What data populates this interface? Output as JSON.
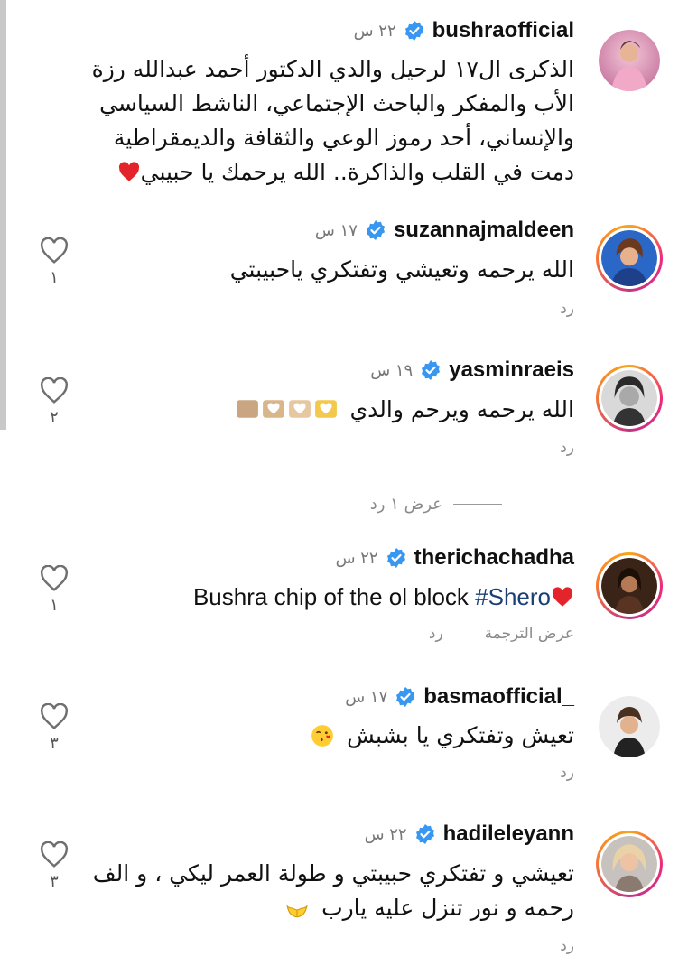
{
  "comments": [
    {
      "username": "bushraofficial",
      "time": "٢٢ س",
      "lines": [
        "الذكرى ال١٧ لرحيل والدي الدكتور أحمد عبدالله رزة",
        "الأب والمفكر والباحث الإجتماعي، الناشط السياسي",
        "والإنساني، أحد رموز الوعي والثقافة والديمقراطية",
        "دمت في القلب والذاكرة.. الله يرحمك يا حبيبي"
      ],
      "emoji_end": "red-heart-emoji"
    },
    {
      "username": "suzannajmaldeen",
      "time": "١٧ س",
      "text": "الله يرحمه وتعيشي وتفتكري ياحبيبتي",
      "reply": "رد",
      "likes": "١"
    },
    {
      "username": "yasminraeis",
      "time": "١٩ س",
      "text": "الله يرحمه ويرحم والدي",
      "emoji_end": "heart-hands-emoji-row",
      "reply": "رد",
      "likes": "٢"
    },
    {
      "username": "therichachadha",
      "time": "٢٢ س",
      "text": "Bushra chip of the ol block ",
      "hashtag": "#Shero",
      "emoji_end": "red-heart-emoji",
      "reply": "رد",
      "translate": "عرض الترجمة",
      "likes": "١"
    },
    {
      "username": "basmaofficial_",
      "time": "١٧ س",
      "text": "تعيش وتفتكري يا بشبش",
      "emoji_end": "kissing-heart-emoji",
      "reply": "رد",
      "likes": "٣"
    },
    {
      "username": "hadileleyann",
      "time": "٢٢ س",
      "lines": [
        "تعيشي و تفتكري حبيبتي و طولة العمر ليكي ، و الف",
        "رحمه و نور تنزل عليه يارب"
      ],
      "emoji_end": "palms-up-together-emoji",
      "reply": "رد",
      "likes": "٣"
    }
  ],
  "view_replies": "عرض ١ رد",
  "icons": {
    "verified": "verified-badge-icon",
    "like": "heart-outline-icon"
  },
  "colors": {
    "verified": "#3897f0",
    "hashtag": "#1b3f75",
    "secondary_text": "#8a8a8a",
    "story_ring_start": "#f9a51a",
    "story_ring_end": "#c13584"
  }
}
